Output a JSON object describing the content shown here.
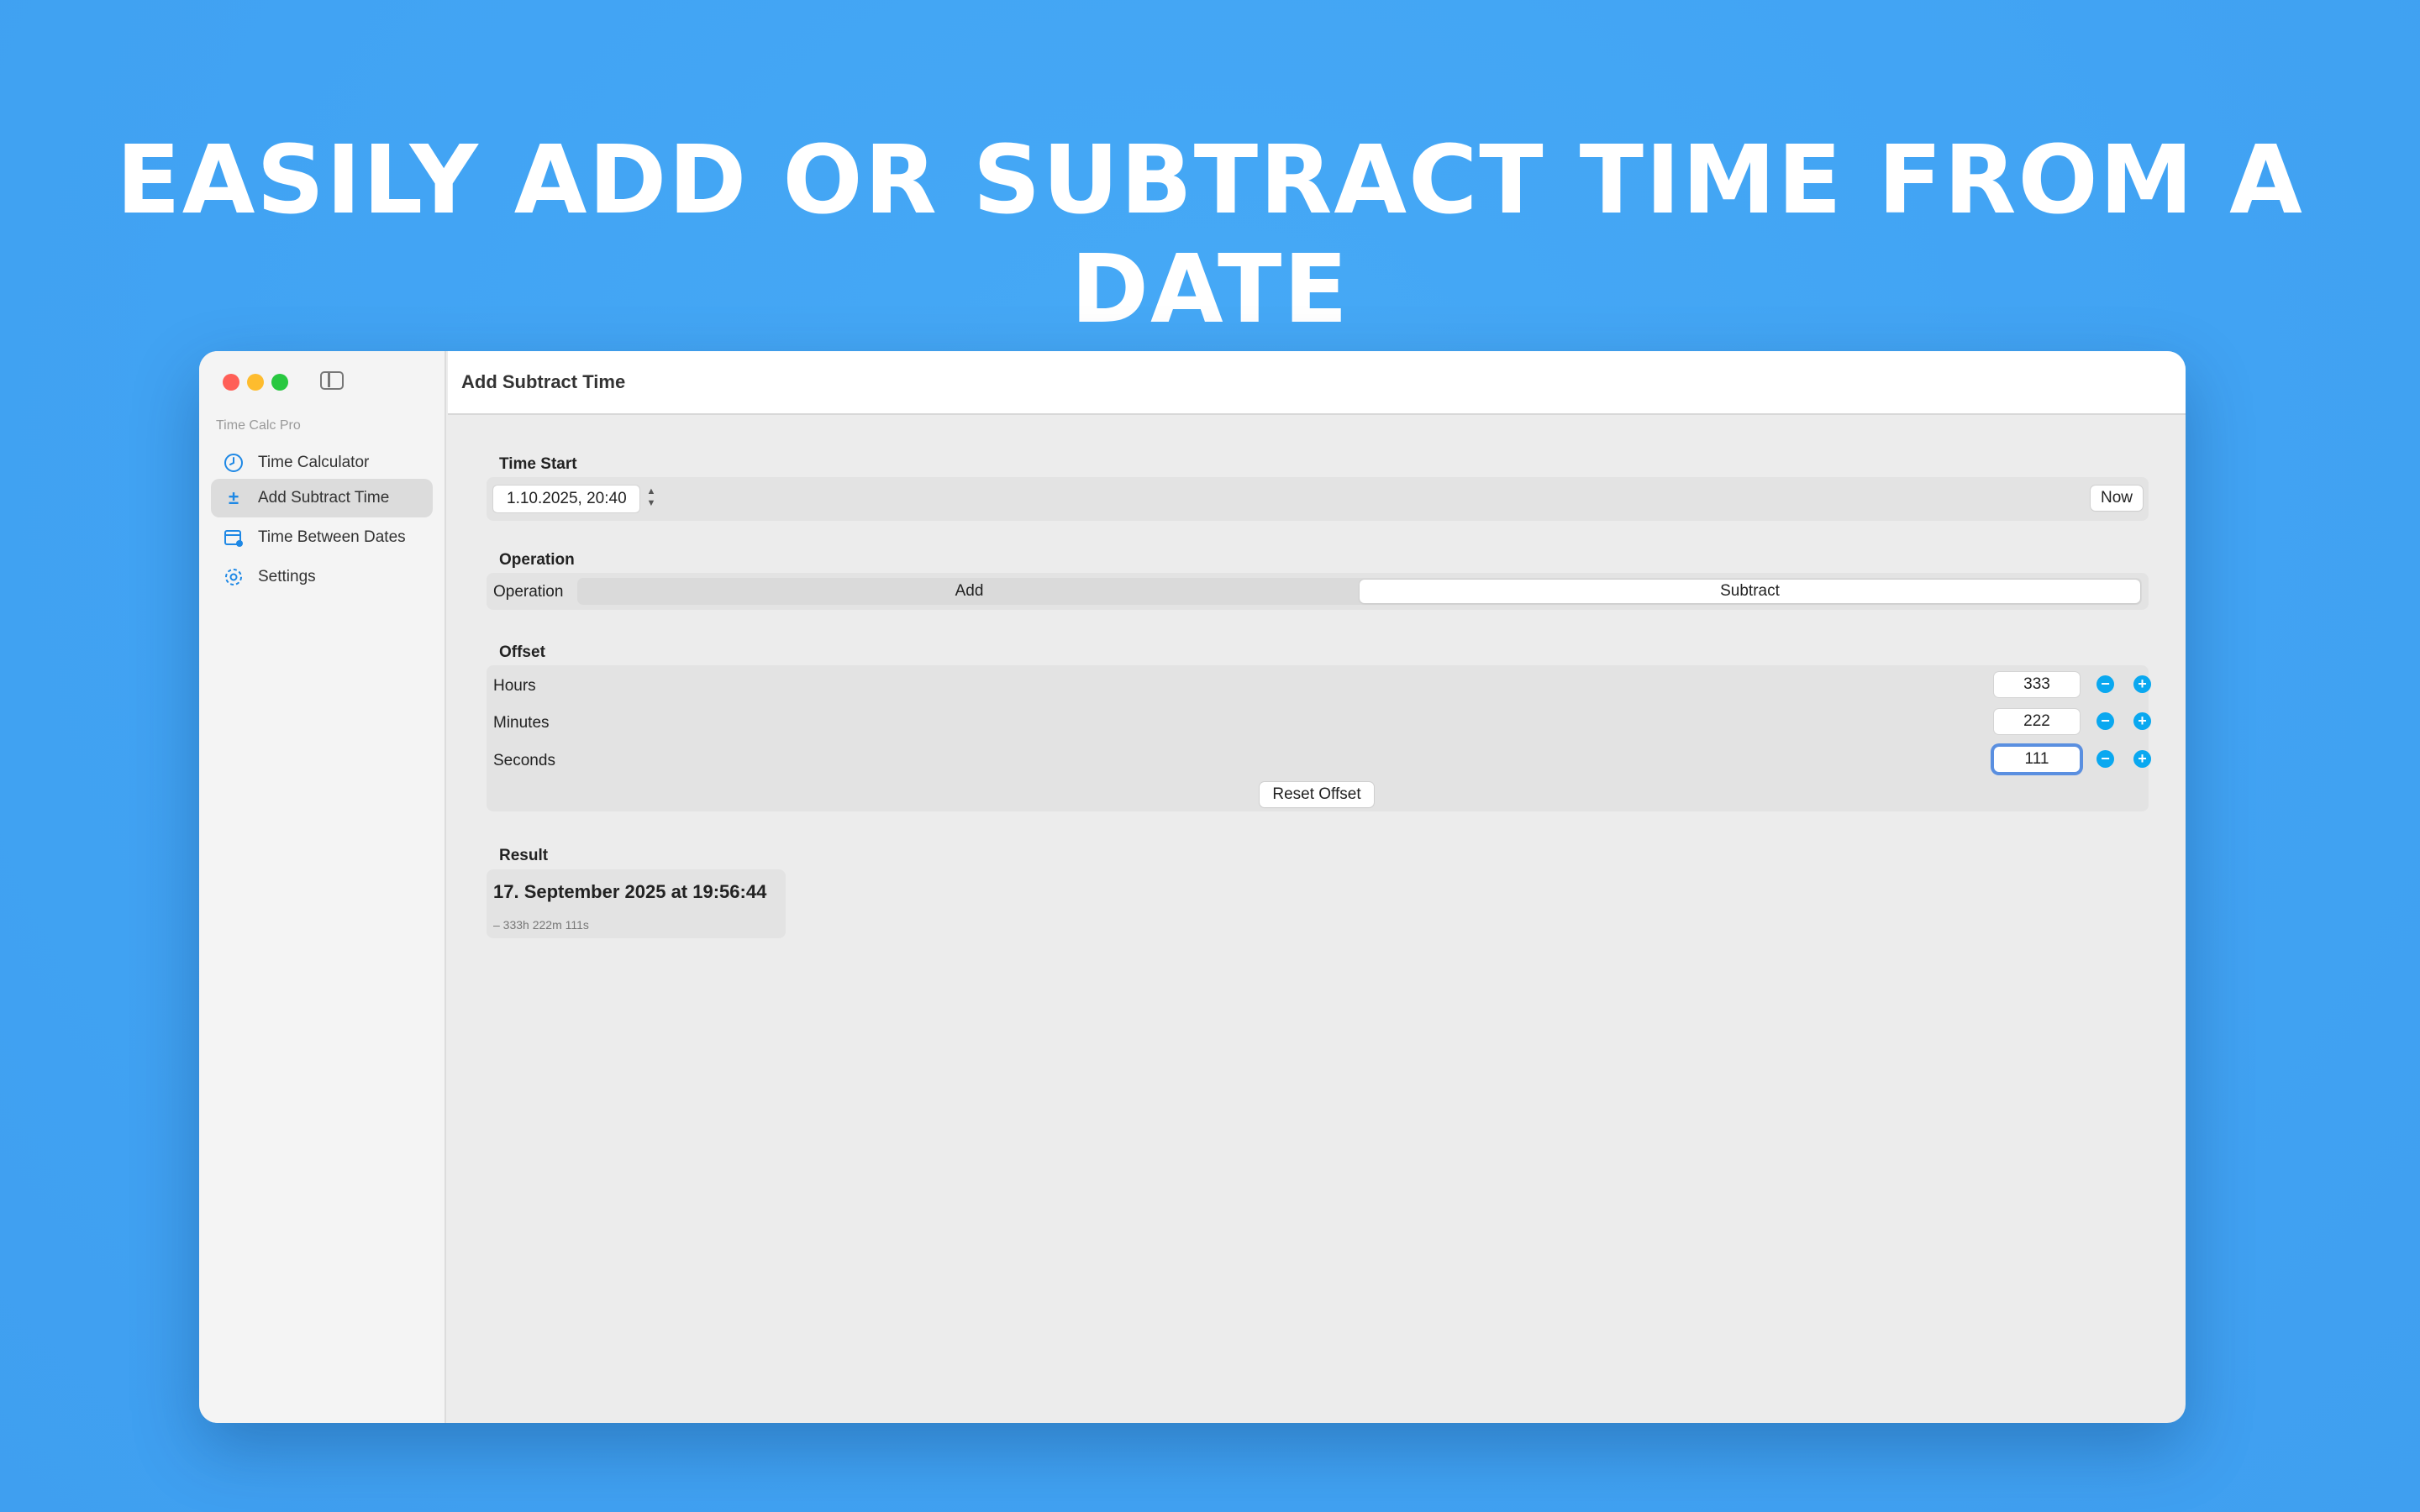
{
  "headline": "EASILY ADD OR SUBTRACT TIME FROM A DATE",
  "sidebar": {
    "section": "Time Calc Pro",
    "items": [
      {
        "label": "Time Calculator",
        "icon": "clock-icon"
      },
      {
        "label": "Add Subtract Time",
        "icon": "plus-minus-icon",
        "active": true
      },
      {
        "label": "Time Between Dates",
        "icon": "calendar-icon"
      },
      {
        "label": "Settings",
        "icon": "gear-icon"
      }
    ]
  },
  "toolbar": {
    "title": "Add Subtract Time"
  },
  "time_start": {
    "title": "Time Start",
    "value": "1.10.2025, 20:40",
    "now_label": "Now"
  },
  "operation": {
    "title": "Operation",
    "label": "Operation",
    "options": [
      "Add",
      "Subtract"
    ],
    "selected": "Subtract"
  },
  "offset": {
    "title": "Offset",
    "rows": [
      {
        "label": "Hours",
        "value": "333"
      },
      {
        "label": "Minutes",
        "value": "222"
      },
      {
        "label": "Seconds",
        "value": "111"
      }
    ],
    "reset_label": "Reset Offset"
  },
  "result": {
    "title": "Result",
    "value": "17. September 2025 at 19:56:44",
    "detail": "– 333h 222m 111s"
  },
  "colors": {
    "background": "#42a5f5",
    "accent": "#0aa8f0",
    "focus_ring": "#5a8fe0"
  }
}
